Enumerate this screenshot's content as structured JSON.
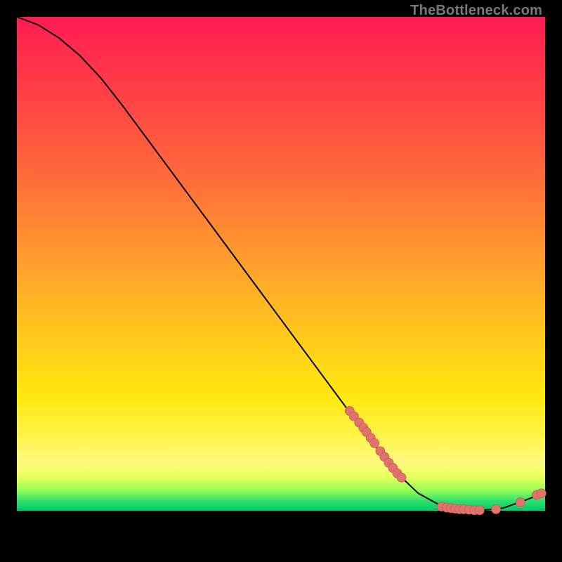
{
  "watermark": "TheBottleneck.com",
  "colors": {
    "background": "#000000",
    "line": "#000000",
    "point_fill": "#e0746c",
    "point_stroke": "#c75a52",
    "gradient_top": "#ff1c52",
    "gradient_mid": "#ffe80f",
    "gradient_green": "#00c96e"
  },
  "chart_data": {
    "type": "line",
    "title": "",
    "xlabel": "",
    "ylabel": "",
    "xlim": [
      0,
      100
    ],
    "ylim": [
      0,
      100
    ],
    "grid": false,
    "legend": false,
    "curve": [
      {
        "x": 0,
        "y": 100
      },
      {
        "x": 4,
        "y": 98.5
      },
      {
        "x": 8,
        "y": 96
      },
      {
        "x": 12,
        "y": 92.6
      },
      {
        "x": 16,
        "y": 88.3
      },
      {
        "x": 20,
        "y": 83.2
      },
      {
        "x": 24,
        "y": 77.8
      },
      {
        "x": 28,
        "y": 72.4
      },
      {
        "x": 32,
        "y": 67.0
      },
      {
        "x": 36,
        "y": 61.6
      },
      {
        "x": 40,
        "y": 56.2
      },
      {
        "x": 44,
        "y": 50.8
      },
      {
        "x": 48,
        "y": 45.4
      },
      {
        "x": 52,
        "y": 40.0
      },
      {
        "x": 56,
        "y": 34.6
      },
      {
        "x": 60,
        "y": 29.2
      },
      {
        "x": 64,
        "y": 23.8
      },
      {
        "x": 68,
        "y": 18.6
      },
      {
        "x": 72,
        "y": 13.6
      },
      {
        "x": 76,
        "y": 9.8
      },
      {
        "x": 80,
        "y": 7.6
      },
      {
        "x": 84,
        "y": 6.8
      },
      {
        "x": 88,
        "y": 6.6
      },
      {
        "x": 92,
        "y": 7.0
      },
      {
        "x": 96,
        "y": 8.4
      },
      {
        "x": 100,
        "y": 10.0
      }
    ],
    "points": [
      {
        "x": 63.0,
        "y": 25.4
      },
      {
        "x": 63.8,
        "y": 24.4
      },
      {
        "x": 64.8,
        "y": 23.2
      },
      {
        "x": 65.6,
        "y": 22.2
      },
      {
        "x": 66.2,
        "y": 21.4
      },
      {
        "x": 67.0,
        "y": 20.3
      },
      {
        "x": 67.7,
        "y": 19.3
      },
      {
        "x": 68.8,
        "y": 17.8
      },
      {
        "x": 69.6,
        "y": 16.7
      },
      {
        "x": 70.4,
        "y": 15.6
      },
      {
        "x": 71.2,
        "y": 14.6
      },
      {
        "x": 72.0,
        "y": 13.6
      },
      {
        "x": 72.8,
        "y": 12.8
      },
      {
        "x": 80.4,
        "y": 7.3
      },
      {
        "x": 81.4,
        "y": 7.1
      },
      {
        "x": 82.2,
        "y": 7.0
      },
      {
        "x": 83.0,
        "y": 6.9
      },
      {
        "x": 83.8,
        "y": 6.8
      },
      {
        "x": 84.6,
        "y": 6.8
      },
      {
        "x": 85.6,
        "y": 6.7
      },
      {
        "x": 86.6,
        "y": 6.6
      },
      {
        "x": 87.6,
        "y": 6.6
      },
      {
        "x": 90.7,
        "y": 6.8
      },
      {
        "x": 95.3,
        "y": 8.1
      },
      {
        "x": 98.4,
        "y": 9.5
      },
      {
        "x": 99.3,
        "y": 9.8
      }
    ]
  }
}
